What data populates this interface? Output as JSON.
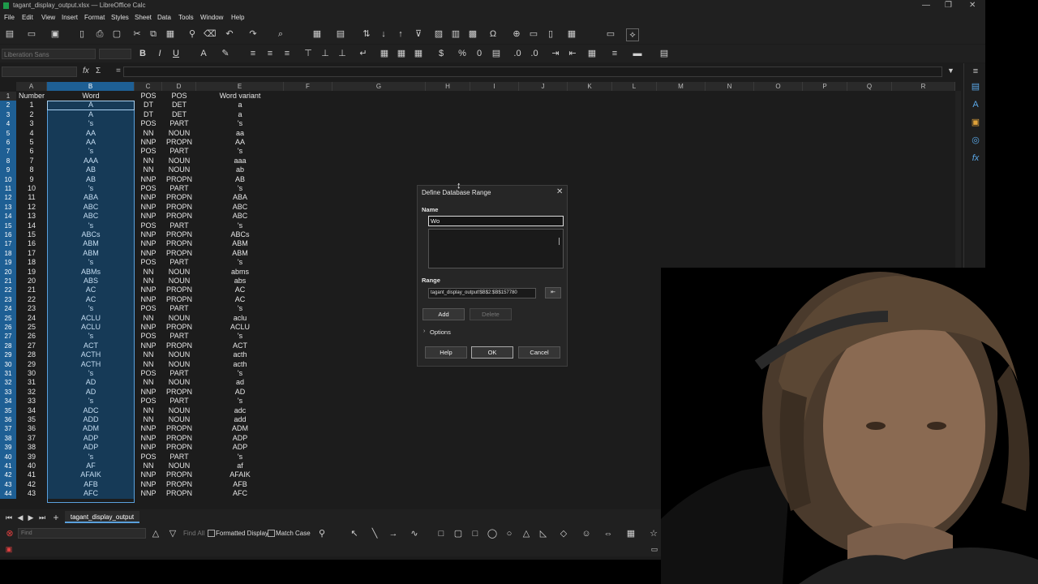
{
  "window": {
    "title": "tagant_display_output.xlsx — LibreOffice Calc",
    "controls": [
      "—",
      "❐",
      "✕"
    ]
  },
  "menu": [
    "File",
    "Edit",
    "View",
    "Insert",
    "Format",
    "Styles",
    "Sheet",
    "Data",
    "Tools",
    "Window",
    "Help"
  ],
  "format_bar": {
    "font_name": "Liberation Sans",
    "bold": "B",
    "italic": "I",
    "underline": "U"
  },
  "formula_bar": {
    "fx": "fx",
    "sigma": "Σ",
    "equals": "=",
    "value": ""
  },
  "columns": [
    "A",
    "B",
    "C",
    "D",
    "E",
    "F",
    "G",
    "H",
    "I",
    "J",
    "K",
    "L",
    "M",
    "N",
    "O",
    "P",
    "Q",
    "R"
  ],
  "header_row": [
    "Number",
    "Word",
    "POS",
    "POS",
    "Word variant"
  ],
  "rows": [
    [
      1,
      "A",
      "DT",
      "DET",
      "a"
    ],
    [
      2,
      "A",
      "DT",
      "DET",
      "a"
    ],
    [
      3,
      "'s",
      "POS",
      "PART",
      "'s"
    ],
    [
      4,
      "AA",
      "NN",
      "NOUN",
      "aa"
    ],
    [
      5,
      "AA",
      "NNP",
      "PROPN",
      "AA"
    ],
    [
      6,
      "'s",
      "POS",
      "PART",
      "'s"
    ],
    [
      7,
      "AAA",
      "NN",
      "NOUN",
      "aaa"
    ],
    [
      8,
      "AB",
      "NN",
      "NOUN",
      "ab"
    ],
    [
      9,
      "AB",
      "NNP",
      "PROPN",
      "AB"
    ],
    [
      10,
      "'s",
      "POS",
      "PART",
      "'s"
    ],
    [
      11,
      "ABA",
      "NNP",
      "PROPN",
      "ABA"
    ],
    [
      12,
      "ABC",
      "NNP",
      "PROPN",
      "ABC"
    ],
    [
      13,
      "ABC",
      "NNP",
      "PROPN",
      "ABC"
    ],
    [
      14,
      "'s",
      "POS",
      "PART",
      "'s"
    ],
    [
      15,
      "ABCs",
      "NNP",
      "PROPN",
      "ABCs"
    ],
    [
      16,
      "ABM",
      "NNP",
      "PROPN",
      "ABM"
    ],
    [
      17,
      "ABM",
      "NNP",
      "PROPN",
      "ABM"
    ],
    [
      18,
      "'s",
      "POS",
      "PART",
      "'s"
    ],
    [
      19,
      "ABMs",
      "NN",
      "NOUN",
      "abms"
    ],
    [
      20,
      "ABS",
      "NN",
      "NOUN",
      "abs"
    ],
    [
      21,
      "AC",
      "NNP",
      "PROPN",
      "AC"
    ],
    [
      22,
      "AC",
      "NNP",
      "PROPN",
      "AC"
    ],
    [
      23,
      "'s",
      "POS",
      "PART",
      "'s"
    ],
    [
      24,
      "ACLU",
      "NN",
      "NOUN",
      "aclu"
    ],
    [
      25,
      "ACLU",
      "NNP",
      "PROPN",
      "ACLU"
    ],
    [
      26,
      "'s",
      "POS",
      "PART",
      "'s"
    ],
    [
      27,
      "ACT",
      "NNP",
      "PROPN",
      "ACT"
    ],
    [
      28,
      "ACTH",
      "NN",
      "NOUN",
      "acth"
    ],
    [
      29,
      "ACTH",
      "NN",
      "NOUN",
      "acth"
    ],
    [
      30,
      "'s",
      "POS",
      "PART",
      "'s"
    ],
    [
      31,
      "AD",
      "NN",
      "NOUN",
      "ad"
    ],
    [
      32,
      "AD",
      "NNP",
      "PROPN",
      "AD"
    ],
    [
      33,
      "'s",
      "POS",
      "PART",
      "'s"
    ],
    [
      34,
      "ADC",
      "NN",
      "NOUN",
      "adc"
    ],
    [
      35,
      "ADD",
      "NN",
      "NOUN",
      "add"
    ],
    [
      36,
      "ADM",
      "NNP",
      "PROPN",
      "ADM"
    ],
    [
      37,
      "ADP",
      "NNP",
      "PROPN",
      "ADP"
    ],
    [
      38,
      "ADP",
      "NNP",
      "PROPN",
      "ADP"
    ],
    [
      39,
      "'s",
      "POS",
      "PART",
      "'s"
    ],
    [
      40,
      "AF",
      "NN",
      "NOUN",
      "af"
    ],
    [
      41,
      "AFAIK",
      "NNP",
      "PROPN",
      "AFAIK"
    ],
    [
      42,
      "AFB",
      "NNP",
      "PROPN",
      "AFB"
    ],
    [
      43,
      "AFC",
      "NNP",
      "PROPN",
      "AFC"
    ]
  ],
  "sheet_tab": "tagant_display_output",
  "find_bar": {
    "placeholder": "Find",
    "find_all": "Find All",
    "formatted_display": "Formatted Display",
    "match_case": "Match Case"
  },
  "dialog": {
    "title": "Define Database Range",
    "name_label": "Name",
    "name_value": "Wo",
    "range_label": "Range",
    "range_value": "tagant_display_output!$B$2:$B$157780",
    "add": "Add",
    "delete": "Delete",
    "options": "Options",
    "help": "Help",
    "ok": "OK",
    "cancel": "Cancel"
  },
  "colors": {
    "accent": "#1e5f94",
    "app_bg": "#1c1c1c",
    "selection": "#163a57",
    "calc_green": "#1e9a4a"
  },
  "icons": {
    "toolbar": [
      "new-icon",
      "open-icon",
      "save-icon",
      "pdf-icon",
      "print-icon",
      "print-preview-icon",
      "cut-icon",
      "copy-icon",
      "paste-icon",
      "clone-icon",
      "clear-icon",
      "undo-icon",
      "redo-icon",
      "find-icon",
      "grid-icon",
      "rows-icon",
      "sort-icon",
      "sort-asc-icon",
      "sort-desc-icon",
      "filter-icon",
      "image-icon",
      "chart-icon",
      "pivot-icon",
      "special-char-icon",
      "hyperlink-icon",
      "comment-icon",
      "header-icon",
      "freeze-icon",
      "split-icon",
      "draw-icon"
    ],
    "sidebar": [
      "menu-icon",
      "properties-icon",
      "styles-icon",
      "gallery-icon",
      "navigator-icon",
      "functions-icon"
    ]
  }
}
